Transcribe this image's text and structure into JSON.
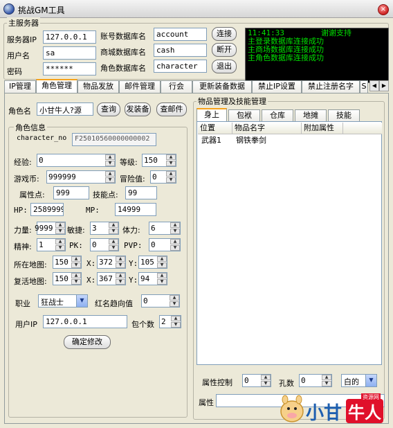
{
  "window": {
    "title": "挑战GM工具",
    "close_icon": "×"
  },
  "server": {
    "group_title": "主服务器",
    "ip_label": "服务器IP",
    "ip_value": "127.0.0.1",
    "user_label": "用户名",
    "user_value": "sa",
    "pwd_label": "密码",
    "pwd_value": "******",
    "account_db_label": "账号数据库名",
    "account_db_value": "account",
    "cash_db_label": "商城数据库名",
    "cash_db_value": "cash",
    "char_db_label": "角色数据库名",
    "char_db_value": "character",
    "connect_button": "连接",
    "disconnect_button": "断开",
    "exit_button": "退出"
  },
  "log": {
    "lines": [
      {
        "time": "11:41:33",
        "text": "谢谢支持"
      },
      {
        "time": "",
        "text": "主登录数据库连接成功"
      },
      {
        "time": "",
        "text": "主商场数据库连接成功"
      },
      {
        "time": "",
        "text": "主角色数据库连接成功"
      }
    ]
  },
  "tabs": [
    "IP管理",
    "角色管理",
    "物品发放",
    "邮件管理",
    "行会",
    "更新装备数据",
    "禁止IP设置",
    "禁止注册名字",
    "S"
  ],
  "active_tab": "角色管理",
  "role": {
    "name_label": "角色名",
    "name_value": "小甘牛人?源",
    "query_button": "查询",
    "send_equip_button": "发装备",
    "check_mail_button": "查邮件",
    "info_title": "角色信息",
    "charno_label": "character_no",
    "charno_value": "F25010560000000002",
    "exp_label": "经验:",
    "exp_value": "0",
    "level_label": "等级:",
    "level_value": "150",
    "money_label": "游戏币:",
    "money_value": "999999",
    "adventure_label": "冒险值:",
    "adventure_value": "0",
    "attr_label": "属性点:",
    "attr_value": "999",
    "skill_label": "技能点:",
    "skill_value": "99",
    "hp_label": "HP:",
    "hp_value": "2589999",
    "mp_label": "MP:",
    "mp_value": "14999",
    "str_label": "力量:",
    "str_value": "9999",
    "agi_label": "敏捷:",
    "agi_value": "3",
    "sta_label": "体力:",
    "sta_value": "6",
    "spi_label": "精神:",
    "spi_value": "1",
    "pk_label": "PK:",
    "pk_value": "0",
    "pvp_label": "PVP:",
    "pvp_value": "0",
    "map_label": "所在地图:",
    "map_value": "150",
    "map_x_label": "X:",
    "map_x": "372",
    "map_y_label": "Y:",
    "map_y": "105",
    "revive_label": "复活地图:",
    "revive_value": "150",
    "revive_x_label": "X:",
    "revive_x": "367",
    "revive_y_label": "Y:",
    "revive_y": "94",
    "job_label": "职业",
    "job_value": "狂战士",
    "red_label": "红名趋向值",
    "red_value": "0",
    "userip_label": "用户IP",
    "userip_value": "127.0.0.1",
    "bag_label": "包个数",
    "bag_value": "2",
    "confirm_button": "确定修改"
  },
  "items": {
    "group_title": "物品管理及技能管理",
    "subtabs": [
      "身上",
      "包袱",
      "仓库",
      "地摊",
      "技能"
    ],
    "active_subtab": "身上",
    "columns": [
      "位置",
      "物品名字",
      "附加属性"
    ],
    "rows": [
      {
        "slot": "武器1",
        "name": "钢铁拳剑",
        "attr": ""
      }
    ],
    "attr_ctrl_label": "属性控制",
    "attr_ctrl_value": "0",
    "hole_label": "孔数",
    "hole_value": "0",
    "quality_value": "白的",
    "attr_label": "属性",
    "attr_value": ""
  },
  "watermark": {
    "text": "小甘",
    "badge": "牛人",
    "sub": "资源网"
  },
  "colors": {
    "log_bg": "#000000",
    "log_text": "#00e000",
    "tab_accent": "#f6a21c",
    "watermark_red": "#e0102a",
    "watermark_blue": "#1e5fb0"
  }
}
